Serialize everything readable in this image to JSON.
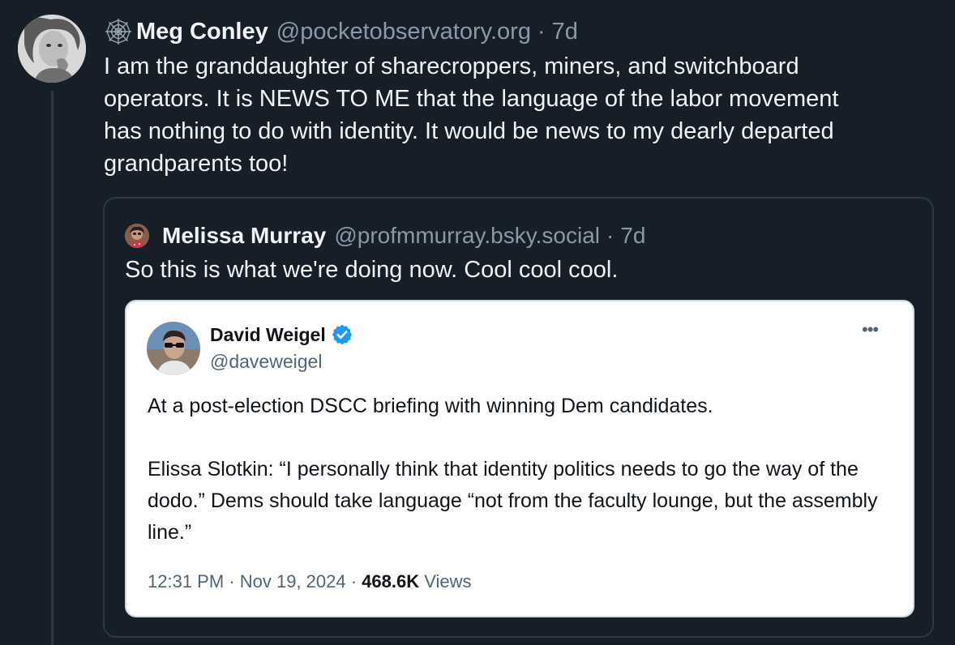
{
  "post": {
    "author_name": "Meg Conley",
    "handle": "@pocketobservatory.org",
    "separator": "·",
    "age": "7d",
    "text": "I am the granddaughter of sharecroppers, miners, and switchboard\noperators. It is NEWS TO ME that the language of the labor movement\nhas nothing to do with identity. It would be news to my dearly departed\ngrandparents too!"
  },
  "quote": {
    "author_name": "Melissa Murray",
    "handle": "@profmmurray.bsky.social",
    "separator": "·",
    "age": "7d",
    "text": "So this is what we're doing now. Cool cool cool."
  },
  "embed": {
    "author_name": "David Weigel",
    "handle": "@daveweigel",
    "more_label": "•••",
    "paragraph_1": "At a post-election DSCC briefing with winning Dem candidates.",
    "paragraph_2": "Elissa Slotkin: “I personally think that identity politics needs to go the way of the dodo.” Dems should take language “not from the faculty lounge, but the assembly line.”",
    "timestamp": "12:31 PM · Nov 19, 2024 · ",
    "views_count": "468.6K",
    "views_label": " Views"
  },
  "colors": {
    "background": "#161e27",
    "text_primary": "#f1f3f5",
    "text_secondary": "#8b98a8",
    "border": "#2c3847",
    "verified_blue": "#1d9bf0"
  },
  "icons": {
    "author_badge": "spiderweb-icon",
    "verified": "verified-badge-icon",
    "more": "more-options-icon"
  }
}
